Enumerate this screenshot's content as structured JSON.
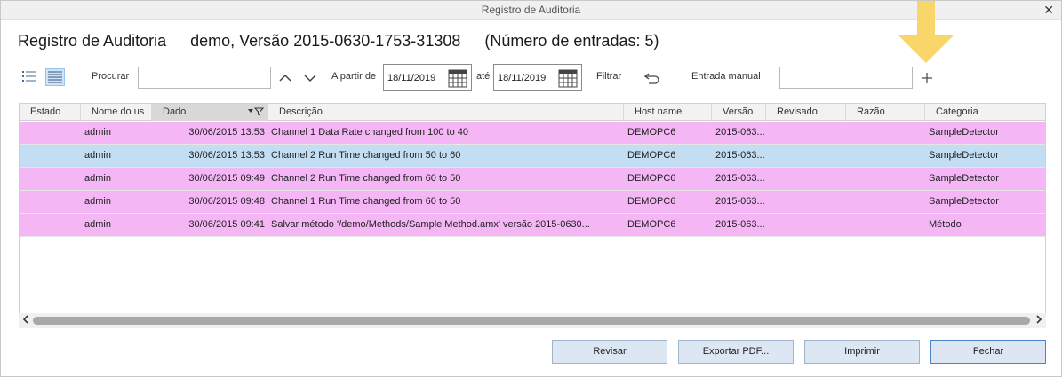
{
  "window": {
    "title": "Registro de Auditoria",
    "close_glyph": "✕"
  },
  "heading": {
    "title": "Registro de Auditoria",
    "context": "demo, Versão 2015-0630-1753-31308",
    "entries": "(Número de entradas: 5)"
  },
  "toolbar": {
    "search_label": "Procurar",
    "search_value": "",
    "from_label": "A partir de",
    "from_date": "18/11/2019",
    "to_label": "até",
    "to_date": "18/11/2019",
    "filter_label": "Filtrar",
    "manual_label": "Entrada manual",
    "manual_value": "",
    "icons": [
      "list-view-icon",
      "detail-view-icon",
      "chevron-up-icon",
      "chevron-down-icon",
      "calendar-icon",
      "undo-icon",
      "plus-icon"
    ]
  },
  "table": {
    "columns": [
      "Estado",
      "Nome do us",
      "Dado",
      "Descrição",
      "Host name",
      "Versão",
      "Revisado",
      "Razão",
      "Categoria"
    ],
    "rows": [
      {
        "estado": "",
        "user": "admin",
        "date": "30/06/2015 13:53",
        "desc": "Channel 1 Data Rate changed from 100 to 40",
        "host": "DEMOPC6",
        "version": "2015-063...",
        "reviewed": "",
        "reason": "",
        "category": "SampleDetector",
        "style": "pink"
      },
      {
        "estado": "",
        "user": "admin",
        "date": "30/06/2015 13:53",
        "desc": "Channel 2 Run Time changed from 50 to 60",
        "host": "DEMOPC6",
        "version": "2015-063...",
        "reviewed": "",
        "reason": "",
        "category": "SampleDetector",
        "style": "blue"
      },
      {
        "estado": "",
        "user": "admin",
        "date": "30/06/2015 09:49",
        "desc": "Channel 2 Run Time changed from 60 to 50",
        "host": "DEMOPC6",
        "version": "2015-063...",
        "reviewed": "",
        "reason": "",
        "category": "SampleDetector",
        "style": "pink"
      },
      {
        "estado": "",
        "user": "admin",
        "date": "30/06/2015 09:48",
        "desc": "Channel 1 Run Time changed from 60 to 50",
        "host": "DEMOPC6",
        "version": "2015-063...",
        "reviewed": "",
        "reason": "",
        "category": "SampleDetector",
        "style": "pink"
      },
      {
        "estado": "",
        "user": "admin",
        "date": "30/06/2015 09:41",
        "desc": "Salvar método '/demo/Methods/Sample Method.amx' versão 2015-0630...",
        "host": "DEMOPC6",
        "version": "2015-063...",
        "reviewed": "",
        "reason": "",
        "category": "Método",
        "style": "pink"
      }
    ]
  },
  "buttons": {
    "review": "Revisar",
    "export": "Exportar PDF...",
    "print": "Imprimir",
    "close": "Fechar"
  },
  "colors": {
    "row_pink": "#f4b6f4",
    "row_blue": "#c3ddf2",
    "arrow": "#f9d66a",
    "button_bg": "#dce7f3"
  }
}
